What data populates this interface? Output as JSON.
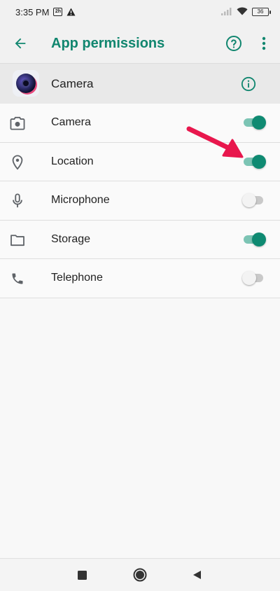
{
  "status_bar": {
    "time": "3:35 PM",
    "notification_icon": "app-notification-icon",
    "warning_icon": "warning-icon",
    "signal_icon": "signal-icon",
    "wifi_icon": "wifi-icon",
    "battery_level": "36"
  },
  "app_bar": {
    "title": "App permissions",
    "back_icon": "arrow-left-icon",
    "help_icon": "help-circle-icon",
    "more_icon": "more-vertical-icon"
  },
  "app_header": {
    "app_name": "Camera",
    "info_icon": "info-icon"
  },
  "permissions": [
    {
      "label": "Camera",
      "icon": "camera-icon",
      "enabled": true
    },
    {
      "label": "Location",
      "icon": "location-pin-icon",
      "enabled": true
    },
    {
      "label": "Microphone",
      "icon": "microphone-icon",
      "enabled": false
    },
    {
      "label": "Storage",
      "icon": "folder-icon",
      "enabled": true
    },
    {
      "label": "Telephone",
      "icon": "phone-icon",
      "enabled": false
    }
  ],
  "colors": {
    "accent": "#11866f",
    "toggle_on_thumb": "#0f8a72",
    "toggle_on_track": "#7cc4b4",
    "annotation_arrow": "#e8174d"
  },
  "nav_bar": {
    "recent_icon": "square-icon",
    "home_icon": "circle-icon",
    "back_icon": "triangle-back-icon"
  }
}
